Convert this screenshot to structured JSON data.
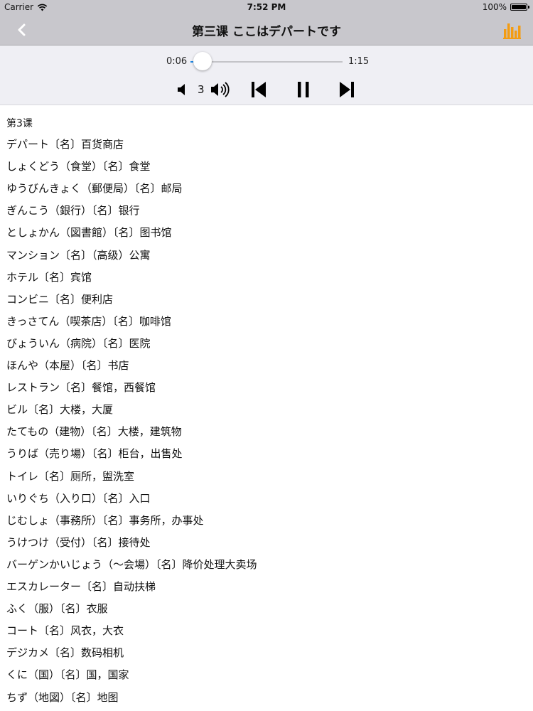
{
  "status_bar": {
    "carrier": "Carrier",
    "time": "7:52 PM",
    "battery": "100%",
    "battery_level": 1.0
  },
  "nav": {
    "title": "第三课 ここはデパートです",
    "back_icon": "chevron-left-icon",
    "right_icon": "chart-bars-icon",
    "accent": "#f39c12"
  },
  "player": {
    "current_time": "0:06",
    "duration": "1:15",
    "progress": 0.08,
    "volume": "3",
    "accent": "#1e88e5"
  },
  "lesson_label": "第3课",
  "entries": [
    "デパート〔名〕百货商店",
    "しょくどう（食堂）〔名〕食堂",
    "ゆうびんきょく（郵便局）〔名〕邮局",
    "ぎんこう（銀行）〔名〕银行",
    "としょかん（図書館）〔名〕图书馆",
    "マンション〔名〕（高级）公寓",
    "ホテル〔名〕宾馆",
    "コンビニ〔名〕便利店",
    "きっさてん（喫茶店）〔名〕咖啡馆",
    "びょういん（病院）〔名〕医院",
    "ほんや（本屋）〔名〕书店",
    "レストラン〔名〕餐馆，西餐馆",
    "ビル〔名〕大楼，大厦",
    "たてもの（建物）〔名〕大楼，建筑物",
    "うりば（売り場）〔名〕柜台，出售处",
    "トイレ〔名〕厕所，盥洗室",
    "いりぐち（入り口）〔名〕入口",
    "じむしょ（事務所）〔名〕事务所，办事处",
    "うけつけ（受付）〔名〕接待处",
    "バーゲンかいじょう（～会場）〔名〕降价处理大卖场",
    "エスカレーター〔名〕自动扶梯",
    "ふく（服）〔名〕衣服",
    "コート〔名〕风衣，大衣",
    "デジカメ〔名〕数码相机",
    "くに（国）〔名〕国，国家",
    "ちず（地図）〔名〕地图"
  ]
}
